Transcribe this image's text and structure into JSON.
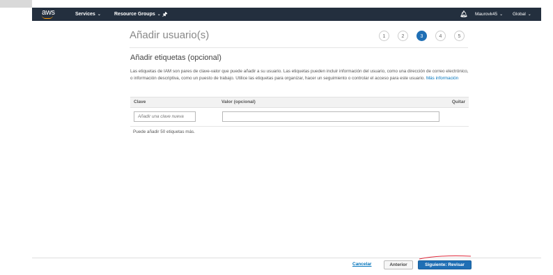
{
  "nav": {
    "logo": "aws",
    "services_label": "Services",
    "resource_groups_label": "Resource Groups",
    "user_label": "Maurovk45",
    "region_label": "Global"
  },
  "page": {
    "title": "Añadir usuario(s)",
    "steps": [
      "1",
      "2",
      "3",
      "4",
      "5"
    ],
    "active_step": "3"
  },
  "section": {
    "title": "Añadir etiquetas (opcional)",
    "description": "Las etiquetas de IAM son pares de clave-valor que puede añadir a su usuario. Las etiquetas pueden incluir información del usuario, como una dirección de correo electrónico, o información descriptiva, como un puesto de trabajo. Utilice las etiquetas para organizar, hacer un seguimiento o controlar el acceso para este usuario.",
    "more_info_link": "Más información"
  },
  "table": {
    "headers": {
      "key": "Clave",
      "value": "Valor (opcional)",
      "remove": "Quitar"
    },
    "key_placeholder": "Añadir una clave nueva",
    "value_placeholder": "",
    "hint": "Puede añadir 50 etiquetas más."
  },
  "footer": {
    "cancel_label": "Cancelar",
    "previous_label": "Anterior",
    "next_label": "Siguiente: Revisar"
  },
  "colors": {
    "nav_bg": "#232f3e",
    "primary": "#1f6fb5",
    "link": "#0073bb"
  }
}
